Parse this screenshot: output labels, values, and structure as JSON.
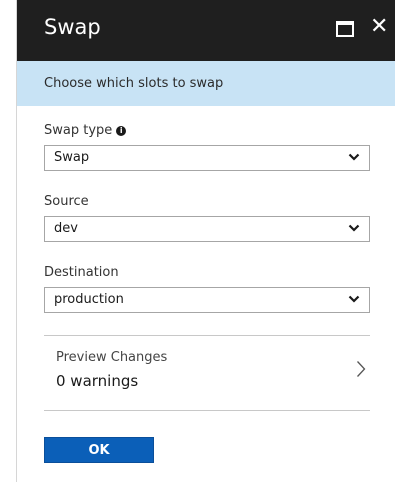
{
  "window": {
    "title": "Swap",
    "maximize_icon": "maximize-icon",
    "close_icon": "close-icon",
    "close_glyph": "✕"
  },
  "banner": {
    "text": "Choose which slots to swap"
  },
  "fields": {
    "swap_type": {
      "label": "Swap type",
      "info_glyph": "i",
      "value": "Swap"
    },
    "source": {
      "label": "Source",
      "value": "dev"
    },
    "destination": {
      "label": "Destination",
      "value": "production"
    }
  },
  "preview": {
    "title": "Preview Changes",
    "count": "0 warnings"
  },
  "actions": {
    "ok_label": "OK"
  }
}
